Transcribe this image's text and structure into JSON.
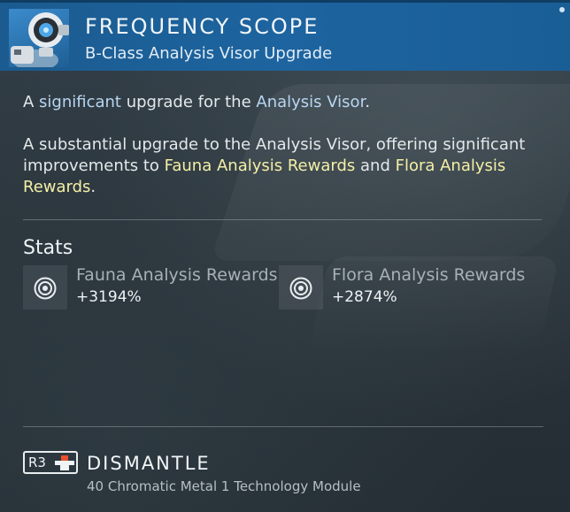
{
  "header": {
    "title": "FREQUENCY SCOPE",
    "subtitle": "B-Class Analysis Visor Upgrade",
    "thumbnail_icon": "drone-icon"
  },
  "description": {
    "line1_pre": "A ",
    "line1_hl1": "significant",
    "line1_mid": " upgrade for the ",
    "line1_hl2": "Analysis Visor",
    "line1_post": ".",
    "p2_pre": "A substantial upgrade to the Analysis Visor, offering significant improvements to ",
    "p2_hl1": "Fauna Analysis Rewards",
    "p2_mid": " and ",
    "p2_hl2": "Flora Analysis Rewards",
    "p2_post": "."
  },
  "stats": {
    "label": "Stats",
    "items": [
      {
        "name": "Fauna Analysis Rewards",
        "value": "+3194%",
        "icon": "target-icon"
      },
      {
        "name": "Flora Analysis Rewards",
        "value": "+2874%",
        "icon": "target-icon"
      }
    ]
  },
  "action": {
    "button_label": "R3",
    "label": "DISMANTLE",
    "cost": "40 Chromatic Metal 1 Technology Module"
  },
  "colors": {
    "header_blue": "#1d64a0",
    "highlight_blue": "#b8d6f2",
    "highlight_yellow": "#f4efa6",
    "background": "#2b353c"
  }
}
